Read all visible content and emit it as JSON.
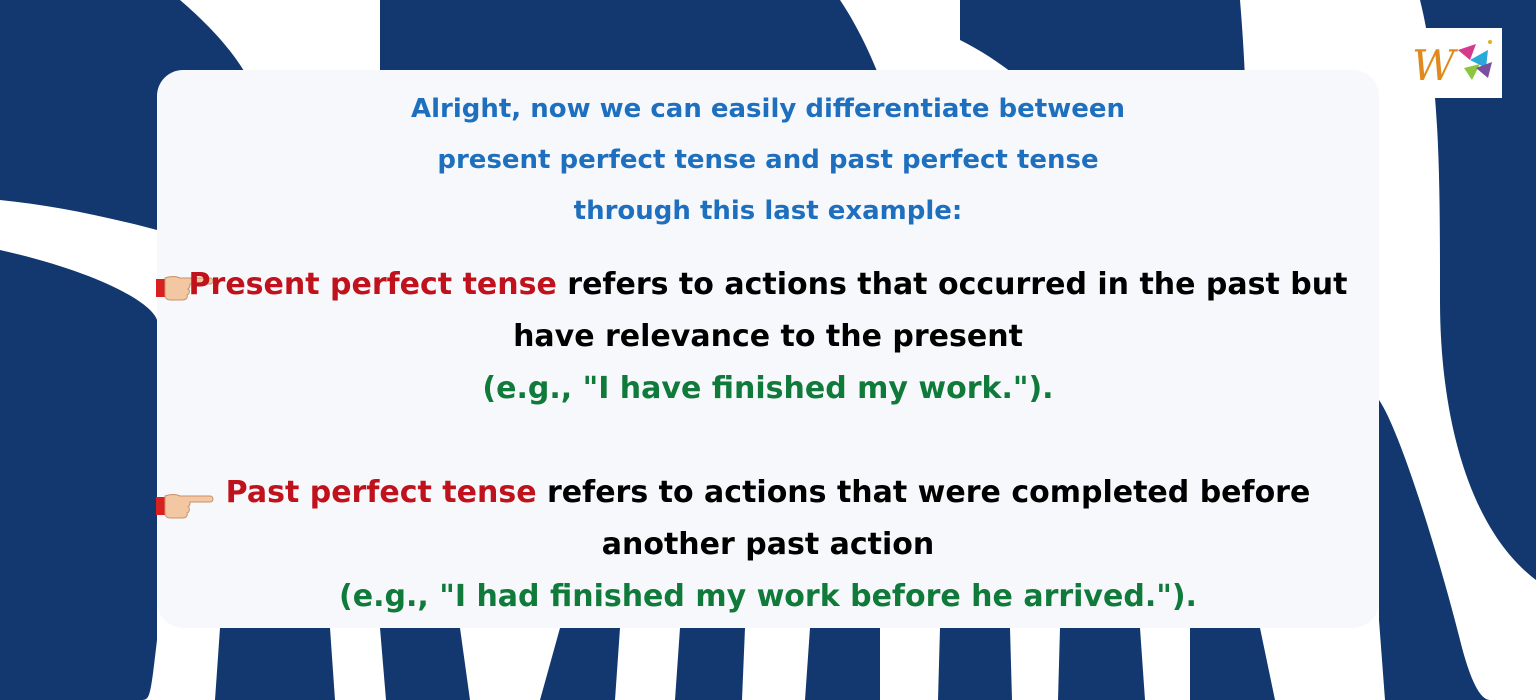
{
  "intro": {
    "line1": "Alright, now we can easily differentiate between",
    "line2": "present perfect tense and past perfect tense",
    "line3": "through this last example:"
  },
  "points": [
    {
      "icon": "pointing-hand-icon",
      "term": "Present perfect tense",
      "rest": " refers to actions that occurred in the past but have relevance to the present",
      "example": "(e.g., \"I have finished my work.\")."
    },
    {
      "icon": "pointing-hand-icon",
      "term": "Past perfect tense",
      "rest": " refers to actions that were completed before another past action",
      "example": "(e.g., \"I had finished my work before he arrived.\")."
    }
  ],
  "colors": {
    "background_navy": "#12386f",
    "intro_blue": "#1f6fbf",
    "term_red": "#c0121c",
    "example_green": "#0f7a3a"
  }
}
